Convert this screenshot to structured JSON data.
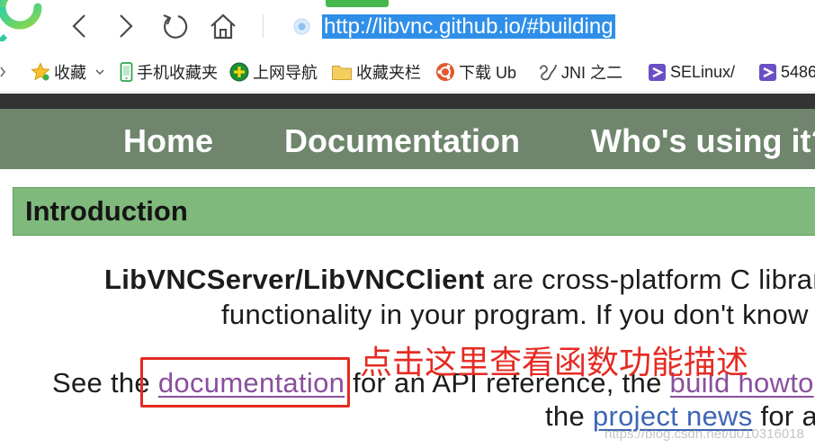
{
  "browser": {
    "url": "http://libvnc.github.io/#building",
    "controls": [
      "browser-logo-icon",
      "chevron-left-icon",
      "chevron-right-icon",
      "refresh-icon",
      "home-icon",
      "site-security-icon"
    ]
  },
  "bookmarks": [
    {
      "label": "收藏",
      "icon": "star-icon"
    },
    {
      "label": "手机收藏夹",
      "icon": "phone-icon"
    },
    {
      "label": "上网导航",
      "icon": "navigation-plus-icon"
    },
    {
      "label": "收藏夹栏",
      "icon": "folder-icon"
    },
    {
      "label": "下载 Ub",
      "icon": "ubuntu-icon"
    },
    {
      "label": "JNI 之二",
      "icon": "swirl-icon"
    },
    {
      "label": "SELinux/",
      "icon": "purple-site-icon"
    },
    {
      "label": "5486",
      "icon": "purple-site-icon"
    }
  ],
  "site": {
    "nav": [
      "Home",
      "Documentation",
      "Who's using it?"
    ],
    "section_title": "Introduction",
    "intro": {
      "lead_bold": "LibVNCServer/LibVNCClient",
      "line1_rest": " are cross-platform C librari",
      "line2": "functionality in your program. If you don't know",
      "line3_pre": "See the ",
      "doc_link": "documentation",
      "line3_mid": " for an API reference, the ",
      "build_link": "build howto",
      "line4_pre": "the ",
      "news_link": "project news",
      "line4_post": " for a"
    }
  },
  "annotation": {
    "text": "点击这里查看函数功能描述"
  },
  "watermark": "https://blog.csdn.net/u010316018",
  "colors": {
    "url_selection": "#2f8fe8",
    "top_band": "#333333",
    "nav_bar": "#6f866d",
    "section_header": "#7fb97c",
    "visited_link": "#8a4f9e",
    "link": "#3d66b5",
    "annotation": "#e52b22"
  }
}
